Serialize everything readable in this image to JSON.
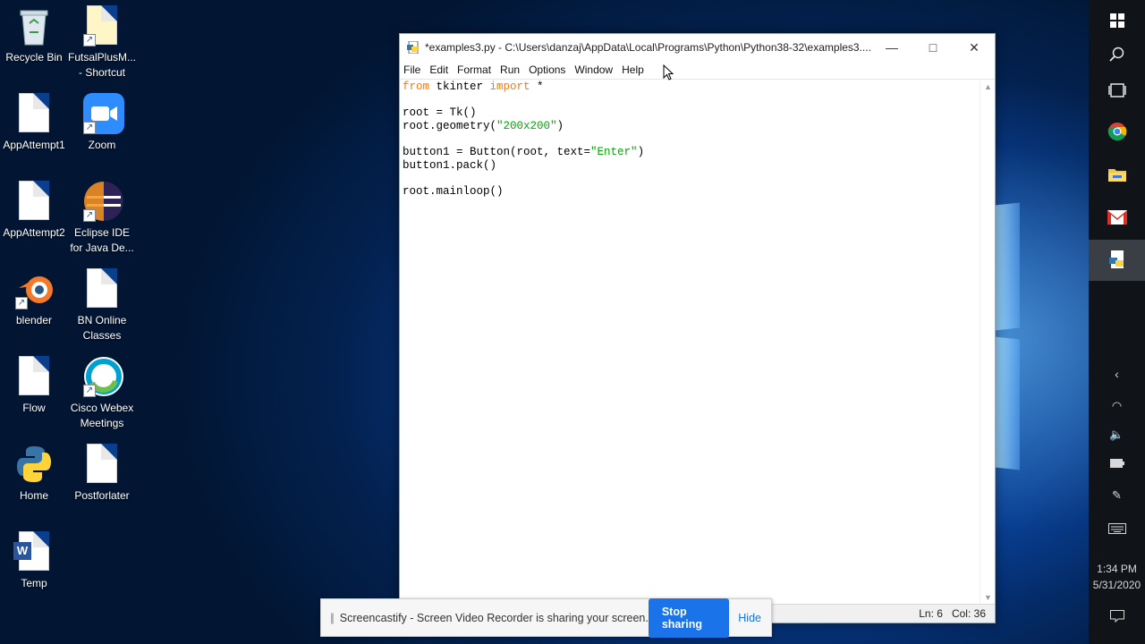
{
  "desktop": {
    "icons": [
      {
        "label": "Recycle Bin",
        "icon": "recycle-bin-icon"
      },
      {
        "label": "FutsalPlusM... - Shortcut",
        "icon": "document-shortcut-icon"
      },
      {
        "label": "AppAttempt1",
        "icon": "document-icon"
      },
      {
        "label": "Zoom",
        "icon": "zoom-icon"
      },
      {
        "label": "AppAttempt2",
        "icon": "document-icon"
      },
      {
        "label": "Eclipse IDE for Java De...",
        "icon": "eclipse-icon"
      },
      {
        "label": "blender",
        "icon": "blender-icon"
      },
      {
        "label": "BN Online Classes",
        "icon": "document-icon"
      },
      {
        "label": "Flow",
        "icon": "document-icon"
      },
      {
        "label": "Cisco Webex Meetings",
        "icon": "webex-icon"
      },
      {
        "label": "Home",
        "icon": "python-file-icon"
      },
      {
        "label": "Postforlater",
        "icon": "document-icon"
      },
      {
        "label": "Temp",
        "icon": "word-doc-icon"
      }
    ]
  },
  "window": {
    "title": "*examples3.py - C:\\Users\\danzaj\\AppData\\Local\\Programs\\Python\\Python38-32\\examples3....",
    "menu": [
      "File",
      "Edit",
      "Format",
      "Run",
      "Options",
      "Window",
      "Help"
    ],
    "code_lines": [
      "from tkinter import *",
      "",
      "root = Tk()",
      "root.geometry(\"200x200\")",
      "",
      "button1 = Button(root, text=\"Enter\")",
      "button1.pack()",
      "",
      "root.mainloop()"
    ],
    "status": {
      "line": "Ln: 6",
      "col": "Col: 36"
    }
  },
  "screencastify": {
    "message": "Screencastify - Screen Video Recorder is sharing your screen.",
    "stop_label": "Stop sharing",
    "hide_label": "Hide"
  },
  "taskbar": {
    "clock_time": "1:34 PM",
    "clock_date": "5/31/2020",
    "pinned": [
      "start-icon",
      "search-icon",
      "task-view-icon",
      "chrome-icon",
      "file-explorer-icon",
      "gmail-icon",
      "python-idle-icon"
    ]
  },
  "colors": {
    "keyword": "#ff7700",
    "string": "#00aa00",
    "accent_button": "#1a73e8"
  }
}
